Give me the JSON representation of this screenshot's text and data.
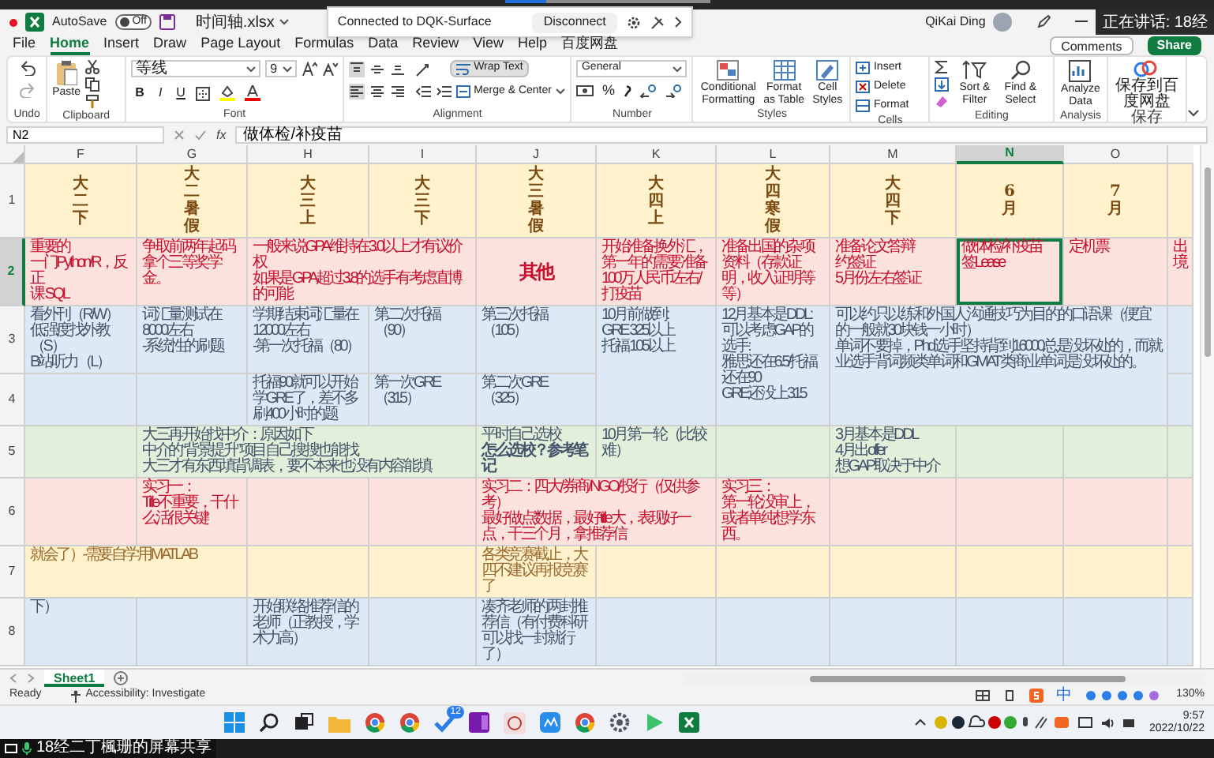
{
  "title_bar": {
    "autosave_label": "AutoSave",
    "autosave": {
      "on": false,
      "label": "Off"
    },
    "file_name": "时间轴.xlsx",
    "connection": {
      "status": "Connected to DQK-Surface",
      "button": "Disconnect"
    },
    "user": "QiKai Ding",
    "speaker": "正在讲话: 18经"
  },
  "menu_tabs": [
    {
      "label": "File",
      "selected": false
    },
    {
      "label": "Home",
      "selected": true
    },
    {
      "label": "Insert",
      "selected": false
    },
    {
      "label": "Draw",
      "selected": false
    },
    {
      "label": "Page Layout",
      "selected": false
    },
    {
      "label": "Formulas",
      "selected": false
    },
    {
      "label": "Data",
      "selected": false
    },
    {
      "label": "Review",
      "selected": false
    },
    {
      "label": "View",
      "selected": false
    },
    {
      "label": "Help",
      "selected": false
    },
    {
      "label": "百度网盘",
      "selected": false
    }
  ],
  "comments_button": "Comments",
  "share_button": "Share",
  "ribbon": {
    "undo": {
      "label": "Undo"
    },
    "clipboard": {
      "label": "Clipboard",
      "paste": "Paste"
    },
    "font": {
      "label": "Font",
      "font_name": "等线",
      "font_size": "9",
      "bold": "B",
      "italic": "I",
      "underline": "U"
    },
    "alignment": {
      "label": "Alignment",
      "vertical_align": [
        {
          "selected": true
        },
        {
          "selected": false
        },
        {
          "selected": false
        }
      ],
      "horizontal_align": [
        {
          "selected": true
        },
        {
          "selected": false
        },
        {
          "selected": false
        }
      ],
      "wrap_text": {
        "label": "Wrap Text",
        "on": true
      },
      "merge_center": "Merge & Center"
    },
    "number": {
      "label": "Number",
      "format": "General",
      "percent": "%"
    },
    "styles": {
      "label": "Styles",
      "conditional": "Conditional Formatting",
      "format_table": "Format as Table",
      "cell_styles": "Cell Styles"
    },
    "cells": {
      "label": "Cells",
      "insert": "Insert",
      "delete": "Delete",
      "format": "Format"
    },
    "editing": {
      "label": "Editing",
      "sort_filter": "Sort & Filter",
      "find_select": "Find & Select"
    },
    "analysis": {
      "label": "Analysis",
      "analyze": "Analyze Data"
    },
    "save": {
      "label": "保存",
      "save_to_cloud": "保存到百度网盘"
    }
  },
  "formula_bar": {
    "function_label": "fx",
    "formula": "做体检/补疫苗"
  },
  "sheet": {
    "name_box": "N2",
    "columns": [
      {
        "label": "F",
        "selected": false
      },
      {
        "label": "G",
        "selected": false
      },
      {
        "label": "H",
        "selected": false
      },
      {
        "label": "I",
        "selected": false
      },
      {
        "label": "J",
        "selected": false
      },
      {
        "label": "K",
        "selected": false
      },
      {
        "label": "L",
        "selected": false
      },
      {
        "label": "M",
        "selected": false
      },
      {
        "label": "N",
        "selected": true
      },
      {
        "label": "O",
        "selected": false
      }
    ],
    "rows": [
      {
        "number": "1",
        "selected": false,
        "color": "#fff2cc",
        "kind": "heading",
        "cells": [
          "大二下",
          "大二暑假",
          "大三上",
          "大三下",
          "大三暑假",
          "大四上",
          "大四寒假",
          "大四下",
          "6月",
          "7月"
        ]
      },
      {
        "number": "2",
        "selected": true,
        "color": "#fbe2dd",
        "kind": "alert",
        "cells": [
          [
            "重要的",
            "一门Python/R，反正",
            "课 SQL"
          ],
          "争取前两年起码拿个三等奖学金。",
          [
            "一般来说GPA维持在3.0以上才有议价权",
            "如果是GPA超过3.8的选手有考虑直博的可能"
          ],
          "",
          {
            "text": "其他",
            "kind": "title"
          },
          "开始准备换外汇，第一年的需要准备100万人民币左右/打疫苗",
          "准备出国的杂项资料（存款证明，收入证明等等）",
          [
            "准备论文答辩",
            "约签证",
            "5月份左右签证"
          ],
          [
            "做体检/补疫苗",
            "签Lease"
          ],
          "定机票",
          "出境"
        ]
      },
      {
        "number": "3",
        "selected": false,
        "color": "#dde9f5",
        "kind": "plain",
        "cells": [
          [
            "看外刊（R/W）",
            "低强度找外教（S）",
            "B站听力（L）"
          ],
          [
            "词汇量测试在8000左右",
            "-系统性的刷题"
          ],
          [
            "学期结束词汇量在12000左右",
            "-第一次托福（80）"
          ],
          "第二次托福（90）",
          "第三次托福（105）",
          [
            "10月前做到:",
            "GRE 325以上",
            "托福 105以上"
          ],
          [
            "12月基本是DDL:",
            "可以考虑GAP的选手:",
            "雅思还在6.5/托福还在90",
            "GRE还没上315"
          ],
          [
            "可以约只以练和外国人沟通技巧为目的的口语课（便宜的一般就30块钱一小时）",
            "单词不要掉，Phd选手坚持背到16000总是没坏处的，而就业选手背词频类单词和GMAT类商业单词是没坏处的。"
          ]
        ]
      },
      {
        "number": "4",
        "selected": false,
        "color": "#dde9f5",
        "kind": "plain",
        "cells": [
          "",
          "",
          "托福90就可以开始学GRE了，差不多刷400小时的题",
          "第一次GRE（315）",
          "第二次GRE（325）"
        ]
      },
      {
        "number": "5",
        "selected": false,
        "color": "#e2efda",
        "kind": "plain",
        "cells": [
          "",
          [
            "大三再开始找中介：原因如下",
            "中介的“背景提升”项目自己搜搜也能找",
            "大三才有东西填背调表，要不本来也没有内容能填"
          ],
          "",
          "",
          [
            "平时自己选校",
            {
              "text": "怎么选校？参考笔记",
              "bold": true
            }
          ],
          "10月第一轮（比较难）",
          "",
          [
            "3月基本是DDL",
            "4月出offer",
            "想GAP取决于中介"
          ]
        ]
      },
      {
        "number": "6",
        "selected": false,
        "color": "#fbe2dd",
        "kind": "alert",
        "cells": [
          "",
          [
            "实习一：",
            "Title不重要，干什么活很关键"
          ],
          "",
          "",
          [
            "实习二：四大/券商/NGO/投行（仅供参考）",
            "最好做点数据，最好title大，表现好一点，干三个月，拿推荐信"
          ],
          "",
          [
            "实习三：",
            "第一轮没审上，或者单纯想学东西。"
          ]
        ]
      },
      {
        "number": "7",
        "selected": false,
        "color": "#fff2cc",
        "kind": "warm",
        "cells": [
          "就会了）-需要自学用MATLAB",
          "",
          "",
          "",
          "各类竞赛截止，大四不建议再报竞赛了"
        ]
      },
      {
        "number": "8",
        "selected": false,
        "color": "#dde9f5",
        "kind": "plain",
        "cells": [
          "下）",
          "",
          "开始联络推荐信的老师（正教授，学术力高）",
          "",
          "凑齐老师的两封推荐信（有付费科研可以找一封就行了）"
        ]
      }
    ]
  },
  "sheet_tabs": [
    {
      "label": "Sheet1",
      "selected": true
    }
  ],
  "status_bar": {
    "ready": "Ready",
    "accessibility": "Accessibility: Investigate",
    "ime": "中",
    "zoom": "130%"
  },
  "taskbar": {
    "todo_badge": "12",
    "time": "9:57",
    "date": "2022/10/22"
  },
  "share_footer": "18经二丁楓珊的屏幕共享"
}
